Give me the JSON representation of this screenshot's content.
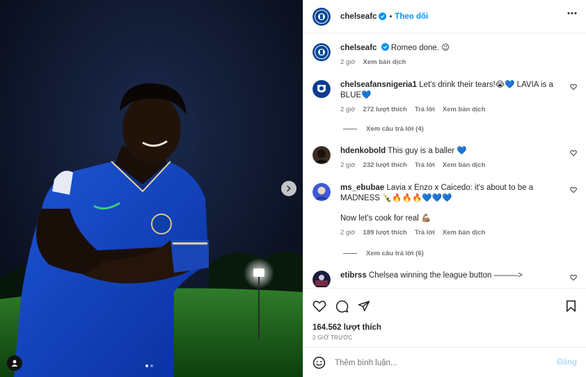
{
  "post": {
    "author": "chelseafc",
    "follow_label": "Theo dõi",
    "caption": "Romeo done. 😉",
    "caption_time": "2 giờ",
    "translate_label": "Xem bản dịch",
    "likes": "164.562 lượt thích",
    "posted_ago": "2 GIỜ TRƯỚC",
    "carousel_count": 2,
    "carousel_index": 1
  },
  "comments": [
    {
      "user": "chelseafansnigeria1",
      "text": "Let's drink their tears!😭💙 LAVIA is a BLUE💙",
      "time": "2 giờ",
      "likes": "272 lượt thích",
      "reply": "Trả lời",
      "translate": "Xem bản dịch",
      "view_replies": "Xem câu trả lời (4)"
    },
    {
      "user": "hdenkobold",
      "text": "This guy is a baller 💙",
      "time": "2 giờ",
      "likes": "232 lượt thích",
      "reply": "Trả lời",
      "translate": "Xem bản dịch"
    },
    {
      "user": "ms_ebubae",
      "text": "Lavia x Enzo x Caicedo: it's about to be a MADNESS 🍾🔥🔥🔥💙💙💙",
      "text2": "Now let's cook for real 💪🏽",
      "time": "2 giờ",
      "likes": "189 lượt thích",
      "reply": "Trả lời",
      "translate": "Xem bản dịch",
      "view_replies": "Xem câu trả lời (6)"
    },
    {
      "user": "etibrss",
      "text": "Chelsea winning the league button ———>"
    }
  ],
  "composer": {
    "placeholder": "Thêm bình luận...",
    "post_label": "Đăng"
  },
  "colors": {
    "accent": "#0095f6",
    "verified": "#0095f6",
    "chelsea_blue": "#034694"
  },
  "icons": [
    "more-icon",
    "heart-icon",
    "comment-icon",
    "share-icon",
    "bookmark-icon",
    "emoji-icon",
    "chevron-right-icon",
    "user-tag-icon",
    "verified-icon"
  ]
}
